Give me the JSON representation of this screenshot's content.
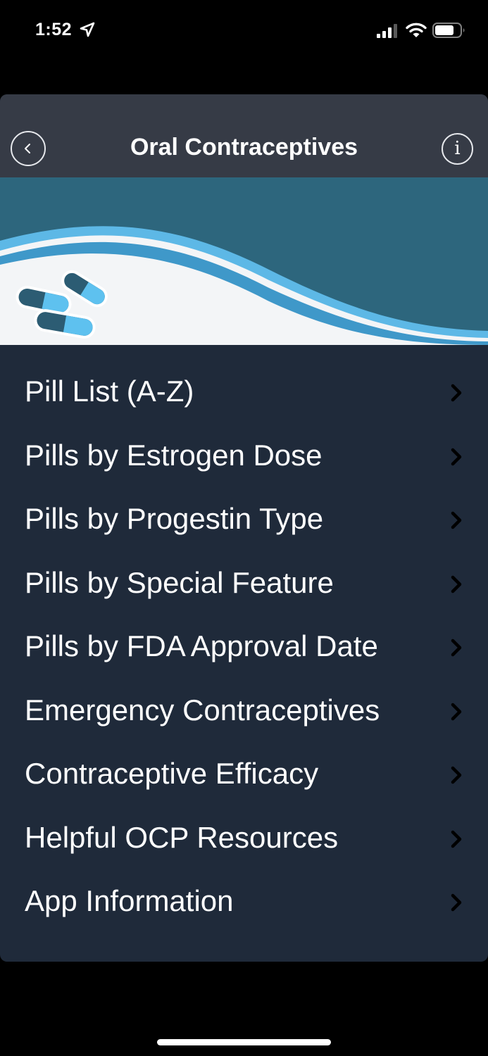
{
  "status_bar": {
    "time": "1:52"
  },
  "header": {
    "title": "Oral Contraceptives",
    "info_glyph": "i"
  },
  "menu": {
    "items": [
      {
        "label": "Pill List (A-Z)"
      },
      {
        "label": "Pills by Estrogen Dose"
      },
      {
        "label": "Pills by Progestin Type"
      },
      {
        "label": "Pills by Special Feature"
      },
      {
        "label": "Pills by FDA Approval Date"
      },
      {
        "label": "Emergency Contraceptives"
      },
      {
        "label": "Contraceptive Efficacy"
      },
      {
        "label": "Helpful OCP Resources"
      },
      {
        "label": "App Information"
      }
    ]
  },
  "icons": {
    "back": "chevron-left-icon",
    "info": "info-icon",
    "row_disclosure": "chevron-right-icon",
    "status": [
      "location-arrow-icon",
      "signal-icon",
      "wifi-icon",
      "battery-icon"
    ]
  },
  "colors": {
    "screen_background": "#000000",
    "header_background": "#363b46",
    "menu_background": "#1f2a3a",
    "banner_teal": "#2d667d",
    "banner_light_blue": "#5db8e6",
    "text": "#ffffff"
  }
}
